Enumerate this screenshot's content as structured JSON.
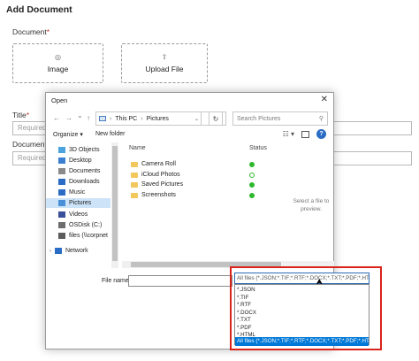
{
  "page": {
    "heading": "Add Document",
    "document_label": "Document",
    "required_mark": "*",
    "upload_image_label": "Image",
    "upload_file_label": "Upload File",
    "title_label": "Title",
    "document_label2": "Document",
    "title_placeholder": "Required",
    "doc_placeholder": "Required"
  },
  "dialog": {
    "title": "Open",
    "close": "✕",
    "nav": {
      "back": "←",
      "forward": "→",
      "dropdown": "⌄",
      "up": "↑"
    },
    "breadcrumb": [
      "This PC",
      "Pictures"
    ],
    "breadcrumb_sep": "›",
    "search_placeholder": "Search Pictures",
    "organize": "Organize ▾",
    "new_folder": "New folder",
    "help": "?",
    "tree": [
      {
        "label": "3D Objects",
        "color": "#4aa3df"
      },
      {
        "label": "Desktop",
        "color": "#3a7fd0"
      },
      {
        "label": "Documents",
        "color": "#8a8a8a"
      },
      {
        "label": "Downloads",
        "color": "#2b6cc4"
      },
      {
        "label": "Music",
        "color": "#2b6cc4"
      },
      {
        "label": "Pictures",
        "color": "#4a90d9"
      },
      {
        "label": "Videos",
        "color": "#3a4f9a"
      },
      {
        "label": "OSDisk (C:)",
        "color": "#6d6d6d"
      },
      {
        "label": "files (\\\\corpnet",
        "color": "#5c5c5c"
      },
      {
        "label": "Network",
        "color": "#2b6cc4"
      }
    ],
    "columns": {
      "name": "Name",
      "status": "Status"
    },
    "files": [
      {
        "name": "Camera Roll",
        "status": "ok"
      },
      {
        "name": "iCloud Photos",
        "status": "synced"
      },
      {
        "name": "Saved Pictures",
        "status": "ok"
      },
      {
        "name": "Screenshots",
        "status": "ok"
      }
    ],
    "preview_text": "Select a file to preview.",
    "file_name_label": "File name:",
    "file_type_selected": "All files (*.JSON;*.TIF;*.RTF;*.DOCX;*.TXT;*.PDF;*.HTML)",
    "file_type_options": [
      "*.JSON",
      "*.TIF",
      "*.RTF",
      "*.DOCX",
      "*.TXT",
      "*.PDF",
      "*.HTML",
      "All files (*.JSON;*.TIF;*.RTF;*.DOCX;*.TXT;*.PDF;*.HTML)"
    ]
  },
  "colors": {
    "accent": "#0078d7",
    "highlight": "#d9241c",
    "selected_tree": "#cce3f8"
  }
}
